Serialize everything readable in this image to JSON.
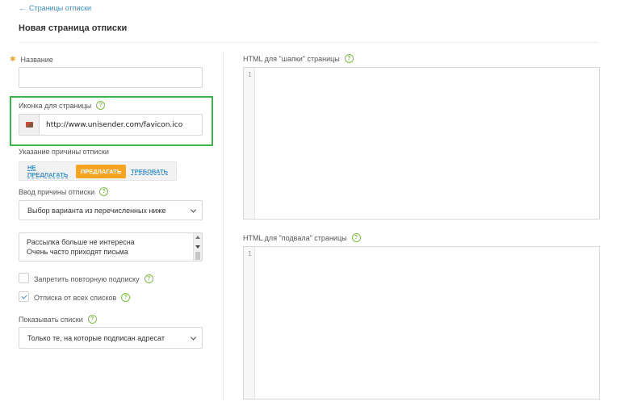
{
  "nav": {
    "back_arrow": "←",
    "back_link": "Страницы отписки"
  },
  "page": {
    "title": "Новая страница отписки"
  },
  "form": {
    "required_marker": "✱",
    "name_label": "Название",
    "name_value": "",
    "icon_label": "Иконка для страницы",
    "icon_url": "http://www.unisender.com/favicon.ico",
    "reason_label": "Указание причины отписки",
    "reason_options": [
      {
        "label": "НЕ ПРЕДЛАГАТЬ",
        "active": false
      },
      {
        "label": "ПРЕДЛАГАТЬ",
        "active": true
      },
      {
        "label": "ТРЕБОВАТЬ",
        "active": false
      }
    ],
    "reason_input_label": "Ввод причины отписки",
    "reason_input_value": "Выбор варианта из перечисленных ниже",
    "reasons_list": [
      "Рассылка больше не интересна",
      "Очень часто приходят письма"
    ],
    "forbid_resubscribe_label": "Запретить повторную подписку",
    "forbid_resubscribe_checked": false,
    "unsubscribe_all_label": "Отписка от всех списков",
    "unsubscribe_all_checked": true,
    "show_lists_label": "Показывать списки",
    "show_lists_value": "Только те, на которые подписан адресат"
  },
  "editors": {
    "header_label": "HTML для \"шапки\" страницы",
    "footer_label": "HTML для \"подвала\" страницы",
    "line_number": "1"
  },
  "help_glyph": "?",
  "colors": {
    "accent": "#3a8ec9",
    "active_option": "#f7a520",
    "help": "#7dbe3e",
    "highlight": "#39b54a"
  }
}
